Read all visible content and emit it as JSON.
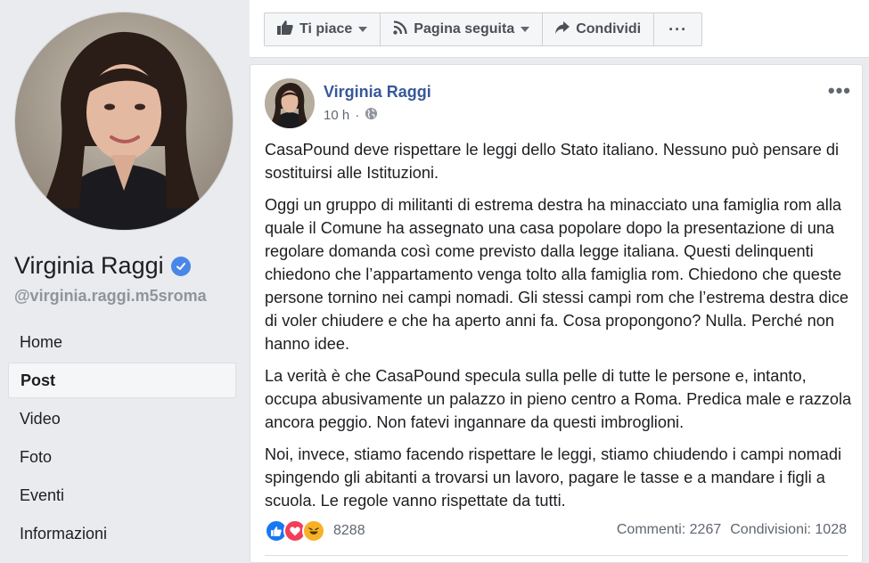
{
  "sidebar": {
    "page_name": "Virginia Raggi",
    "handle": "@virginia.raggi.m5sroma",
    "nav": [
      "Home",
      "Post",
      "Video",
      "Foto",
      "Eventi",
      "Informazioni"
    ],
    "active_item": "Post"
  },
  "toolbar": {
    "like_label": "Ti piace",
    "follow_label": "Pagina seguita",
    "share_label": "Condividi",
    "more_label": "···"
  },
  "post": {
    "author": "Virginia Raggi",
    "time": "10 h",
    "separator": "·",
    "menu_label": "•••",
    "paragraphs": [
      "CasaPound deve rispettare le leggi dello Stato italiano. Nessuno può pensare di sostituirsi alle Istituzioni.",
      "Oggi un gruppo di militanti di estrema destra ha minacciato una famiglia rom alla quale il Comune ha assegnato una casa popolare dopo la presentazione di una regolare domanda così come previsto dalla legge italiana. Questi delinquenti chiedono che l’appartamento venga tolto alla famiglia rom. Chiedono che queste persone tornino nei campi nomadi. Gli stessi campi rom che l’estrema destra dice di voler chiudere e che ha aperto anni fa. Cosa propongono? Nulla. Perché non hanno idee.",
      "La verità è che CasaPound specula sulla pelle di tutte le persone e, intanto, occupa abusivamente un palazzo in pieno centro a Roma. Predica male e razzola ancora peggio. Non fatevi ingannare da questi imbroglioni.",
      "Noi, invece, stiamo facendo rispettare le leggi, stiamo chiudendo i campi nomadi spingendo gli abitanti a trovarsi un lavoro, pagare le tasse e a mandare i figli a scuola. Le regole vanno rispettate da tutti."
    ],
    "reactions_count": "8288",
    "comments": "Commenti: 2267",
    "shares": "Condivisioni: 1028"
  },
  "colors": {
    "link_blue": "#385898",
    "verified_blue": "#4a86e8",
    "like_blue": "#1877f2",
    "love_red": "#f33e58",
    "haha_yellow": "#f7b125"
  },
  "icons": [
    "like-thumb-icon",
    "rss-follow-icon",
    "share-arrow-icon",
    "globe-icon",
    "verified-badge-icon"
  ]
}
